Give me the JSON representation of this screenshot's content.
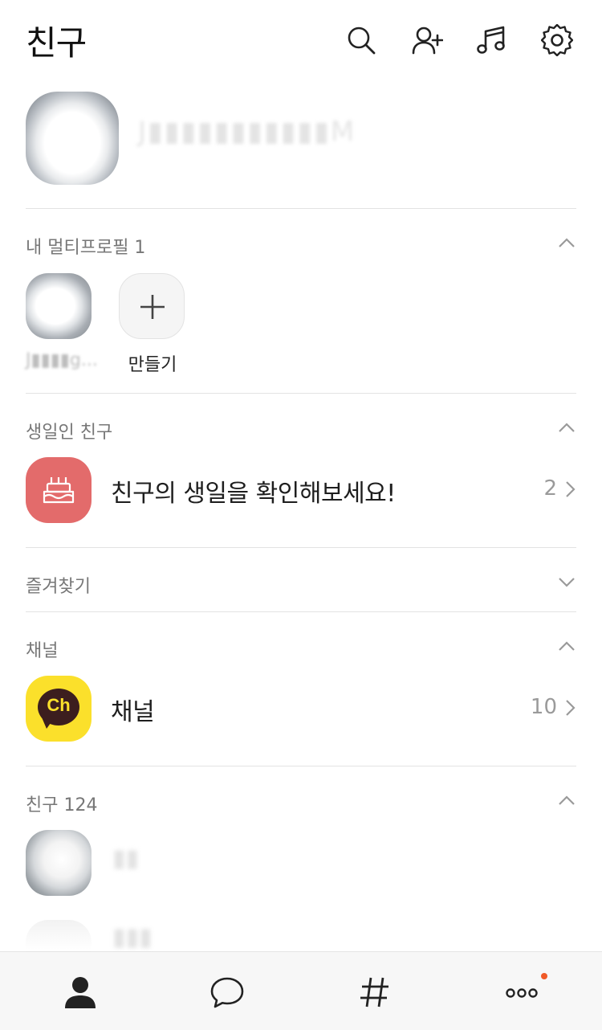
{
  "header": {
    "title": "친구",
    "icons": [
      "search-icon",
      "add-friend-icon",
      "music-icon",
      "settings-icon"
    ]
  },
  "my_profile": {
    "name": "J▮▮▮▮▮▮▮▮▮▮▮M"
  },
  "sections": {
    "multi_profile": {
      "label": "내 멀티프로필 1",
      "items": [
        {
          "label": "J▮▮▮▮g..."
        },
        {
          "label": "만들기"
        }
      ]
    },
    "birthday": {
      "label": "생일인 친구",
      "row_title": "친구의 생일을 확인해보세요!",
      "count": "2"
    },
    "favorites": {
      "label": "즐겨찾기"
    },
    "channel": {
      "label": "채널",
      "row_title": "채널",
      "count": "10",
      "icon_text": "Ch"
    },
    "friends": {
      "label": "친구 124",
      "items": [
        {
          "name": "▮▮"
        },
        {
          "name": "▮▮▮"
        }
      ]
    }
  },
  "tabbar": {
    "tabs": [
      "friends-tab",
      "chats-tab",
      "view-tab",
      "more-tab"
    ],
    "badge_color": "#f05a28"
  },
  "colors": {
    "birthday_bg": "#e36b6b",
    "channel_bg": "#fbe02b",
    "channel_bubble": "#3c1e1e"
  }
}
